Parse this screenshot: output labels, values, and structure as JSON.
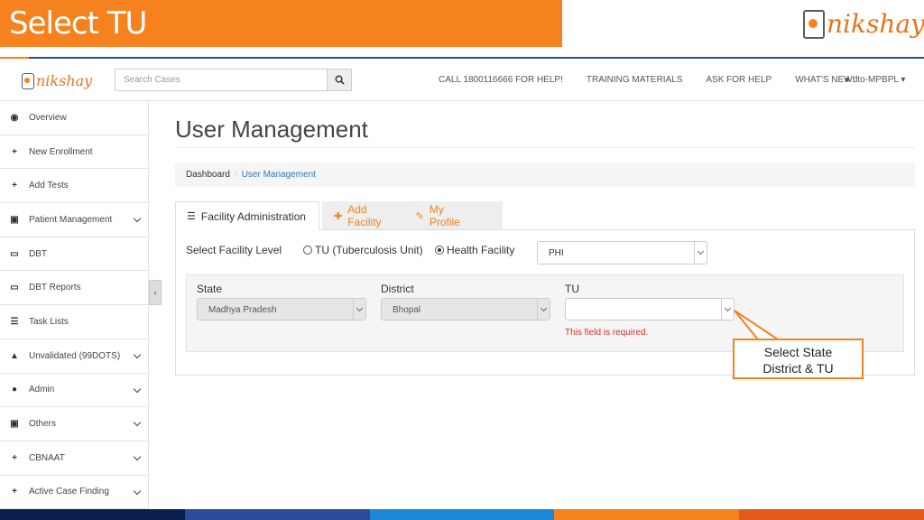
{
  "slide": {
    "title": "Select TU",
    "logo_text": "nikshay",
    "callout_text": "Select State\nDistrict & TU"
  },
  "navbar": {
    "logo_text": "nikshay",
    "search_placeholder": "Search Cases",
    "links": [
      "CALL 1800116666 FOR HELP!",
      "TRAINING MATERIALS",
      "ASK FOR HELP",
      "WHAT'S NEW!"
    ],
    "user": "dto-MPBPL"
  },
  "sidebar": {
    "items": [
      {
        "label": "Overview",
        "icon": "dashboard-icon",
        "glyph": "◉",
        "chevron": false
      },
      {
        "label": "New Enrollment",
        "icon": "plus-icon",
        "glyph": "+",
        "chevron": false
      },
      {
        "label": "Add Tests",
        "icon": "plus-icon",
        "glyph": "+",
        "chevron": false
      },
      {
        "label": "Patient Management",
        "icon": "id-card-icon",
        "glyph": "▣",
        "chevron": true
      },
      {
        "label": "DBT",
        "icon": "money-icon",
        "glyph": "▭",
        "chevron": false
      },
      {
        "label": "DBT Reports",
        "icon": "money-icon",
        "glyph": "▭",
        "chevron": false
      },
      {
        "label": "Task Lists",
        "icon": "list-icon",
        "glyph": "☰",
        "chevron": false
      },
      {
        "label": "Unvalidated (99DOTS)",
        "icon": "warning-icon",
        "glyph": "▲",
        "chevron": true
      },
      {
        "label": "Admin",
        "icon": "user-icon",
        "glyph": "●",
        "chevron": true
      },
      {
        "label": "Others",
        "icon": "id-card-icon",
        "glyph": "▣",
        "chevron": true
      },
      {
        "label": "CBNAAT",
        "icon": "plus-icon",
        "glyph": "+",
        "chevron": true
      },
      {
        "label": "Active Case Finding",
        "icon": "plus-icon",
        "glyph": "+",
        "chevron": true
      }
    ]
  },
  "main": {
    "title": "User Management",
    "breadcrumb": [
      "Dashboard",
      "User Management"
    ],
    "tabs": [
      "Facility Administration",
      "Add Facility",
      "My Profile"
    ],
    "facility_level_label": "Select Facility Level",
    "radio_tu": "TU (Tuberculosis Unit)",
    "radio_hf": "Health Facility",
    "facility_level_value": "PHI",
    "state_label": "State",
    "state_value": "Madhya Pradesh",
    "district_label": "District",
    "district_value": "Bhopal",
    "tu_label": "TU",
    "tu_value": "",
    "error": "This field is required."
  },
  "colors": {
    "accent": "#f5821f",
    "footer": [
      "#0b1f4d",
      "#2b4c9b",
      "#1e88d8",
      "#f5821f",
      "#e35a1c"
    ]
  }
}
